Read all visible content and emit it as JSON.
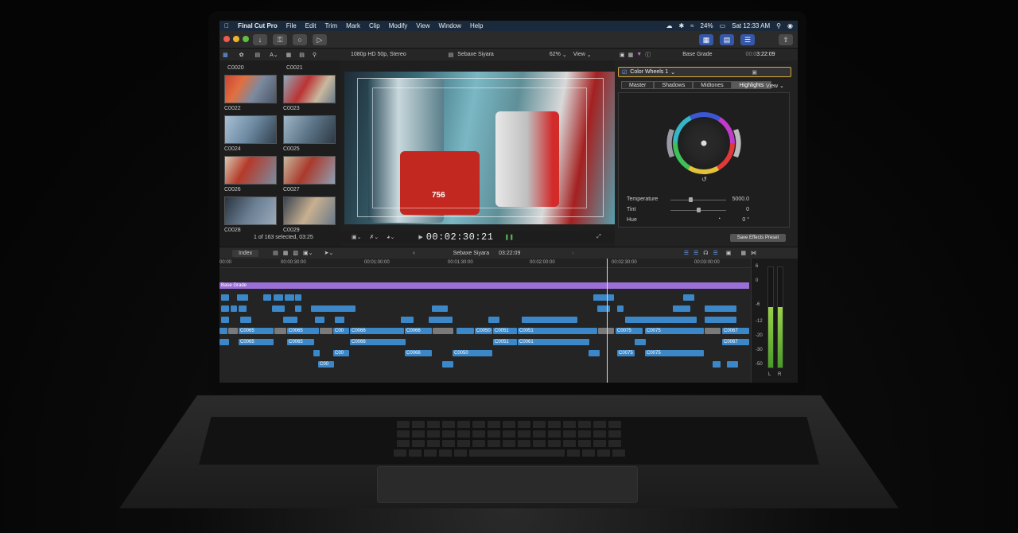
{
  "menubar": {
    "app": "Final Cut Pro",
    "items": [
      "File",
      "Edit",
      "Trim",
      "Mark",
      "Clip",
      "Modify",
      "View",
      "Window",
      "Help"
    ],
    "battery": "24%",
    "clock": "Sat 12:33 AM"
  },
  "browser": {
    "clips": [
      "C0020",
      "C0021",
      "C0022",
      "C0023",
      "C0024",
      "C0025",
      "C0026",
      "C0027",
      "C0028",
      "C0029"
    ],
    "status": "1 of 163 selected, 03:25"
  },
  "viewer": {
    "format": "1080p HD 50p, Stereo",
    "project": "Sebaxe Siyara",
    "zoom": "62%",
    "view_menu": "View",
    "timecode": "00:02:30:21",
    "can_label": "756"
  },
  "inspector": {
    "title": "Base Grade",
    "duration": "3:22:09",
    "duration_prefix": "00:0",
    "effect": "Color Wheels 1",
    "tabs": [
      "Master",
      "Shadows",
      "Midtones",
      "Highlights"
    ],
    "active_tab": "Highlights",
    "view_menu": "View",
    "params": [
      {
        "label": "Temperature",
        "value": "5000.0",
        "level": 0.35
      },
      {
        "label": "Tint",
        "value": "0",
        "level": 0.5
      },
      {
        "label": "Hue",
        "value": "0 °"
      }
    ],
    "save_button": "Save Effects Preset"
  },
  "timeline": {
    "index_button": "Index",
    "project": "Sebaxe Siyara",
    "duration": "03:22:09",
    "ruler": [
      "00:00",
      "00:00:30:00",
      "00:01:00:00",
      "00:01:30:00",
      "00:02:00:00",
      "00:02:30:00",
      "00:03:00:00"
    ],
    "storyline": "Base Grade",
    "clips": [
      "C0065",
      "C0065",
      "C0066",
      "C0066",
      "C0050",
      "C0051",
      "C0051",
      "C0075",
      "C0067",
      "C0065",
      "C0065",
      "C0066",
      "C0066",
      "C0051",
      "C0061",
      "C0075",
      "C0067",
      "C00",
      "C0066",
      "C0050",
      "C0075",
      "C0075",
      "C00"
    ]
  },
  "meters": {
    "scale": [
      "6",
      "0",
      "-6",
      "-12",
      "-20",
      "-30",
      "-50"
    ],
    "channels": [
      "L",
      "R"
    ],
    "levels": [
      0.6,
      0.6
    ]
  }
}
